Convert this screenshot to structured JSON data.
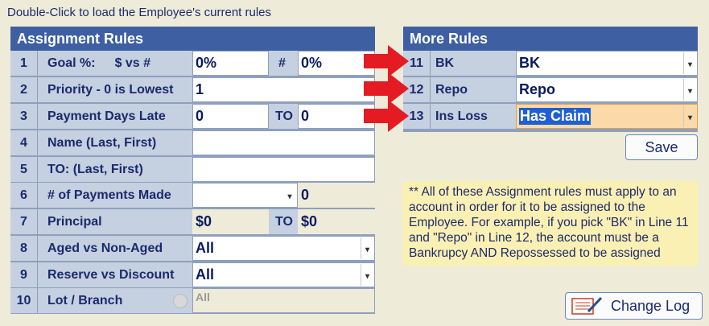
{
  "hint": "Double-Click to load the Employee's current rules",
  "assignment": {
    "title": "Assignment Rules",
    "rows": [
      {
        "num": "1",
        "label": "Goal %:",
        "sublabel": "$ vs #",
        "value": "0%",
        "mid": "#",
        "value2": "0%"
      },
      {
        "num": "2",
        "label": "Priority - 0 is Lowest",
        "value": "1"
      },
      {
        "num": "3",
        "label": "Payment Days Late",
        "value": "0",
        "mid": "TO",
        "value2": "0"
      },
      {
        "num": "4",
        "label": "Name (Last, First)",
        "value": ""
      },
      {
        "num": "5",
        "label": "TO: (Last, First)",
        "value": ""
      },
      {
        "num": "6",
        "label": "# of Payments Made",
        "value": "",
        "value2": "0"
      },
      {
        "num": "7",
        "label": "Principal",
        "value": "$0",
        "mid": "TO",
        "value2": "$0"
      },
      {
        "num": "8",
        "label": "Aged vs Non-Aged",
        "value": "All"
      },
      {
        "num": "9",
        "label": "Reserve vs Discount",
        "value": "All"
      },
      {
        "num": "10",
        "label": "Lot / Branch",
        "value": "All"
      }
    ]
  },
  "more": {
    "title": "More Rules",
    "rows": [
      {
        "num": "11",
        "label": "BK",
        "value": "BK"
      },
      {
        "num": "12",
        "label": "Repo",
        "value": "Repo"
      },
      {
        "num": "13",
        "label": "Ins Loss",
        "value": "Has Claim"
      }
    ]
  },
  "save_label": "Save",
  "note": "** All of these Assignment rules must apply to an account in order for it to be assigned to the Employee. For example, if you pick \"BK\" in Line 11 and \"Repo\" in Line 12, the account must be a Bankrupcy AND Repossessed to be assigned",
  "changelog_label": "Change Log",
  "colors": {
    "header": "#3f5fa3",
    "arrow": "#e51b24",
    "highlight": "#fbd9a8"
  }
}
